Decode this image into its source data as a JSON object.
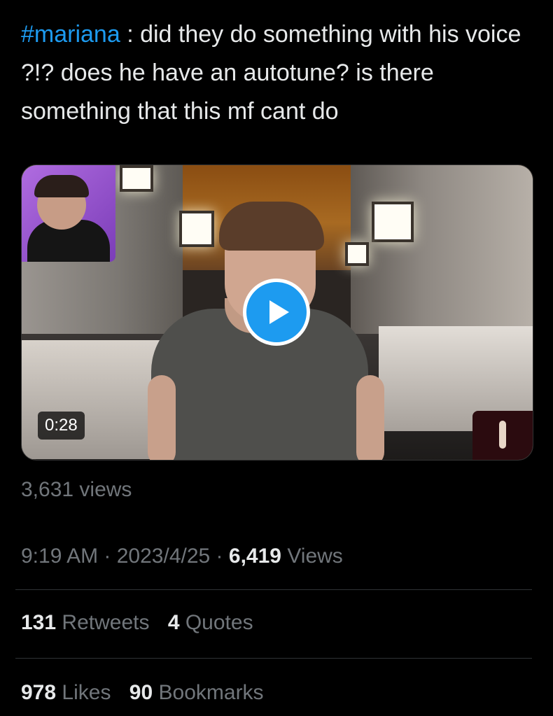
{
  "tweet": {
    "hashtag": "#mariana",
    "text": " : did they do something with his voice ?!? does he have an autotune? is there something that this mf cant do"
  },
  "video": {
    "duration": "0:28",
    "views_label": "3,631 views"
  },
  "meta": {
    "time": "9:19 AM",
    "separator1": " · ",
    "date": "2023/4/25",
    "separator2": " · ",
    "views_count": "6,419",
    "views_word": "Views"
  },
  "engagement": {
    "retweets_count": "131",
    "retweets_label": "Retweets",
    "quotes_count": "4",
    "quotes_label": "Quotes",
    "likes_count": "978",
    "likes_label": "Likes",
    "bookmarks_count": "90",
    "bookmarks_label": "Bookmarks"
  },
  "colors": {
    "background": "#000000",
    "text": "#e7e9ea",
    "muted": "#71767b",
    "accent": "#1d9bf0"
  },
  "icons": {
    "play": "play-icon"
  }
}
